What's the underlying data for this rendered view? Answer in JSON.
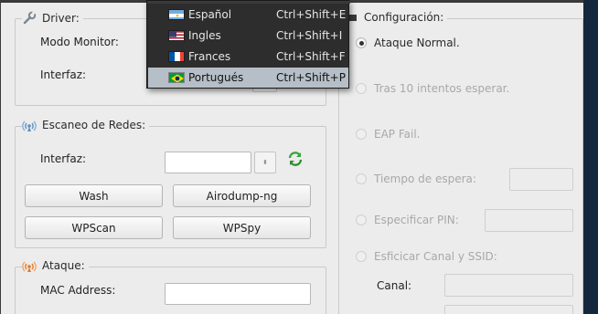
{
  "driver": {
    "title": "Driver:",
    "modo_monitor_label": "Modo Monitor:",
    "interfaz_label": "Interfaz:"
  },
  "escaneo": {
    "title": "Escaneo de Redes:",
    "interfaz_label": "Interfaz:",
    "interfaz_value": "",
    "buttons": {
      "wash": "Wash",
      "airodump": "Airodump-ng",
      "wpscan": "WPScan",
      "wpspy": "WPSpy"
    }
  },
  "ataque": {
    "title": "Ataque:",
    "mac_label": "MAC Address:",
    "mac_value": ""
  },
  "configuracion": {
    "title": "Configuración:",
    "options": {
      "normal": "Ataque Normal.",
      "tras10": "Tras 10 intentos esperar.",
      "eap": "EAP Fail.",
      "tiempo": "Tiempo de espera:",
      "pin": "Especificar PIN:",
      "canal_ssid": "Esficicar Canal y SSID:"
    },
    "selected": "normal",
    "canal_label": "Canal:"
  },
  "language_menu": {
    "items": [
      {
        "label": "Español",
        "shortcut": "Ctrl+Shift+E",
        "flag": "argentina-flag-icon"
      },
      {
        "label": "Ingles",
        "shortcut": "Ctrl+Shift+I",
        "flag": "usa-flag-icon"
      },
      {
        "label": "Frances",
        "shortcut": "Ctrl+Shift+F",
        "flag": "france-flag-icon"
      },
      {
        "label": "Portugués",
        "shortcut": "Ctrl+Shift+P",
        "flag": "brazil-flag-icon"
      }
    ],
    "active_index": 3
  },
  "colors": {
    "window_bg": "#ececec",
    "menu_bg": "#2d2d2d",
    "menu_highlight": "#b6bfc8",
    "refresh_green": "#3aa53a"
  }
}
